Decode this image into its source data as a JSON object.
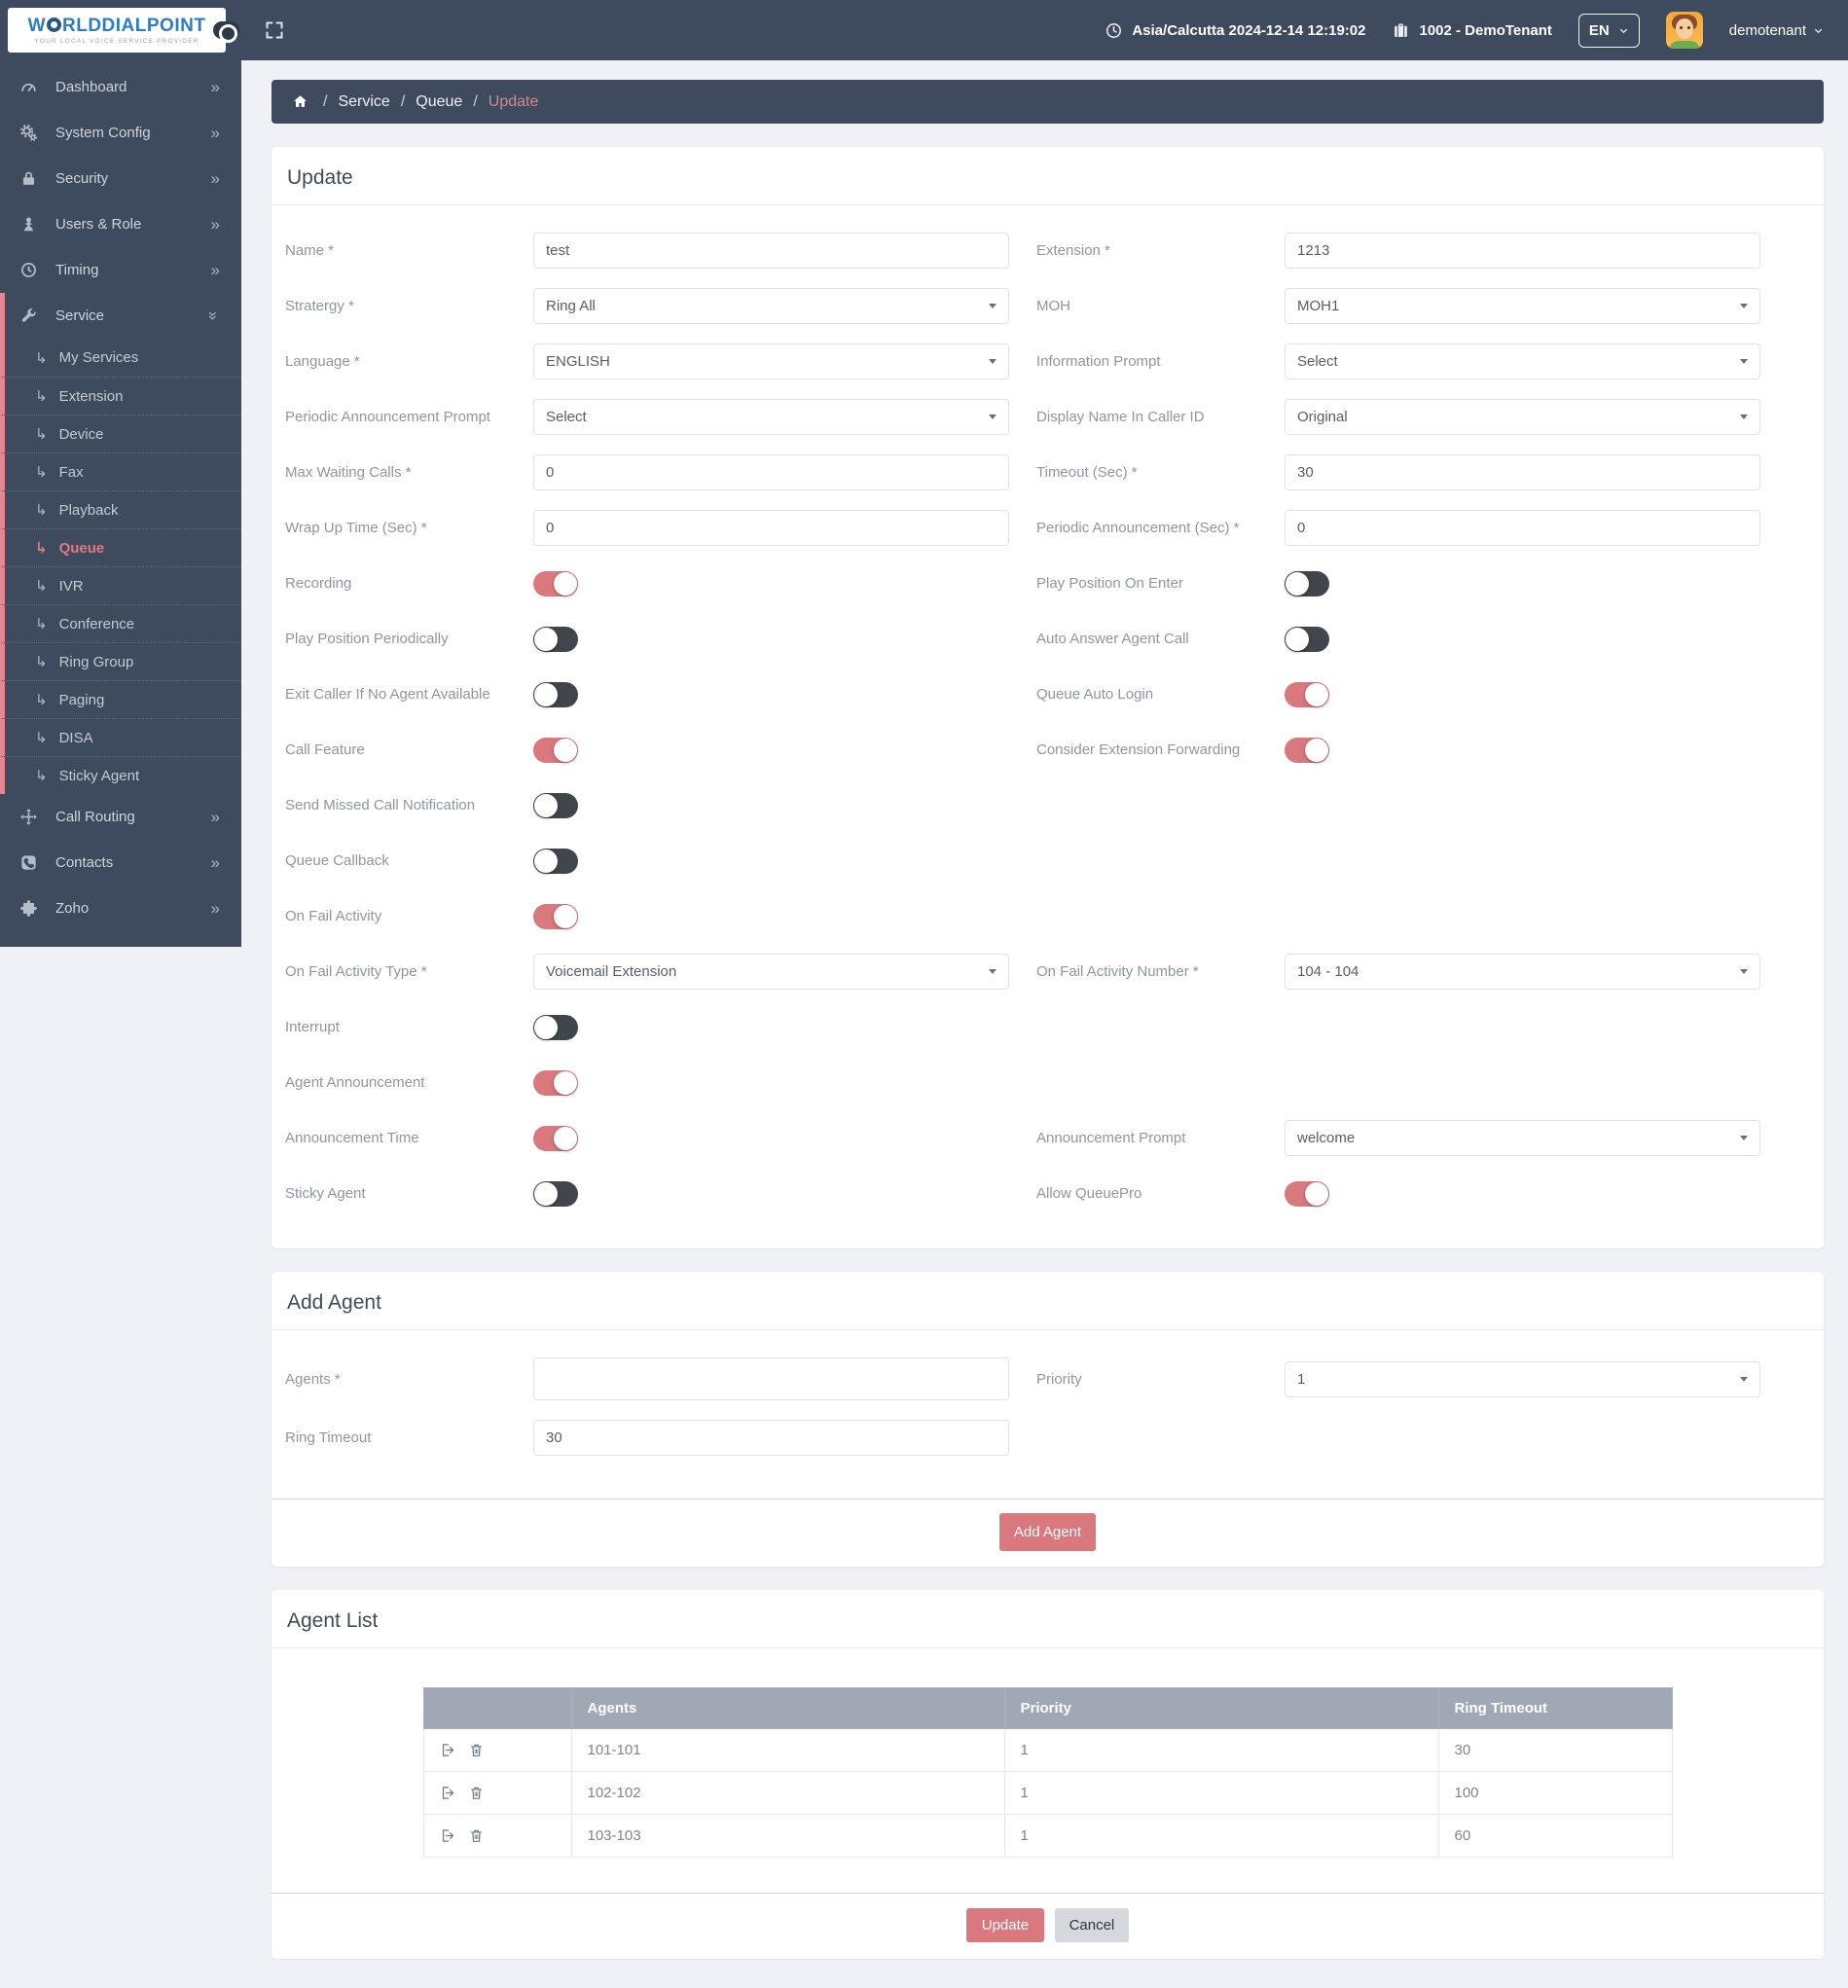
{
  "colors": {
    "accent": "#d9787d",
    "dark_bar": "#3e4b5f",
    "table_header": "#a1a8b5",
    "active_link": "#e0787f",
    "brand_blue": "#2f7bbd"
  },
  "header": {
    "brand": "WORLDDIALPOINT",
    "tagline": "YOUR LOCAL VOICE SERVICE PROVIDER",
    "timezone": "Asia/Calcutta 2024-12-14 12:19:02",
    "tenant": "1002 - DemoTenant",
    "language": "EN",
    "username": "demotenant"
  },
  "sidebar": {
    "items": [
      {
        "label": "Dashboard",
        "icon": "gauge",
        "chevron": "right"
      },
      {
        "label": "System Config",
        "icon": "gears",
        "chevron": "right"
      },
      {
        "label": "Security",
        "icon": "lock",
        "chevron": "right"
      },
      {
        "label": "Users & Role",
        "icon": "user",
        "chevron": "right"
      },
      {
        "label": "Timing",
        "icon": "clock",
        "chevron": "right"
      },
      {
        "label": "Service",
        "icon": "wrench",
        "chevron": "down",
        "pink": true
      },
      {
        "label": "My Services",
        "sub": true
      },
      {
        "label": "Extension",
        "sub": true
      },
      {
        "label": "Device",
        "sub": true
      },
      {
        "label": "Fax",
        "sub": true
      },
      {
        "label": "Playback",
        "sub": true
      },
      {
        "label": "Queue",
        "sub": true,
        "active": true
      },
      {
        "label": "IVR",
        "sub": true
      },
      {
        "label": "Conference",
        "sub": true
      },
      {
        "label": "Ring Group",
        "sub": true
      },
      {
        "label": "Paging",
        "sub": true
      },
      {
        "label": "DISA",
        "sub": true
      },
      {
        "label": "Sticky Agent",
        "sub": true
      },
      {
        "label": "Call Routing",
        "icon": "move",
        "chevron": "right"
      },
      {
        "label": "Contacts",
        "icon": "phone",
        "chevron": "right"
      },
      {
        "label": "Zoho",
        "icon": "puzzle",
        "chevron": "right"
      }
    ]
  },
  "breadcrumb": {
    "items": [
      {
        "label": "Service",
        "active": false
      },
      {
        "label": "Queue",
        "active": false
      },
      {
        "label": "Update",
        "active": true
      }
    ]
  },
  "update_form": {
    "title": "Update",
    "rows": [
      [
        {
          "label": "Name *",
          "type": "input",
          "value": "test"
        },
        {
          "label": "Extension *",
          "type": "input",
          "value": "1213"
        }
      ],
      [
        {
          "label": "Stratergy *",
          "type": "select",
          "value": "Ring All"
        },
        {
          "label": "MOH",
          "type": "select",
          "value": "MOH1"
        }
      ],
      [
        {
          "label": "Language *",
          "type": "select",
          "value": "ENGLISH"
        },
        {
          "label": "Information Prompt",
          "type": "select",
          "value": "Select"
        }
      ],
      [
        {
          "label": "Periodic Announcement Prompt",
          "type": "select",
          "value": "Select"
        },
        {
          "label": "Display Name In Caller ID",
          "type": "select",
          "value": "Original"
        }
      ],
      [
        {
          "label": "Max Waiting Calls *",
          "type": "input",
          "value": "0"
        },
        {
          "label": "Timeout (Sec) *",
          "type": "input",
          "value": "30"
        }
      ],
      [
        {
          "label": "Wrap Up Time (Sec) *",
          "type": "input",
          "value": "0"
        },
        {
          "label": "Periodic Announcement (Sec) *",
          "type": "input",
          "value": "0"
        }
      ],
      [
        {
          "label": "Recording",
          "type": "toggle",
          "on": true
        },
        {
          "label": "Play Position On Enter",
          "type": "toggle",
          "on": false
        }
      ],
      [
        {
          "label": "Play Position Periodically",
          "type": "toggle",
          "on": false
        },
        {
          "label": "Auto Answer Agent Call",
          "type": "toggle",
          "on": false
        }
      ],
      [
        {
          "label": "Exit Caller If No Agent Available",
          "type": "toggle",
          "on": false
        },
        {
          "label": "Queue Auto Login",
          "type": "toggle",
          "on": true
        }
      ],
      [
        {
          "label": "Call Feature",
          "type": "toggle",
          "on": true
        },
        {
          "label": "Consider Extension Forwarding",
          "type": "toggle",
          "on": true
        }
      ],
      [
        {
          "label": "Send Missed Call Notification",
          "type": "toggle",
          "on": false
        },
        null
      ],
      [
        {
          "label": "Queue Callback",
          "type": "toggle",
          "on": false
        },
        null
      ],
      [
        {
          "label": "On Fail Activity",
          "type": "toggle",
          "on": true
        },
        null
      ],
      [
        {
          "label": "On Fail Activity Type *",
          "type": "select",
          "value": "Voicemail Extension"
        },
        {
          "label": "On Fail Activity Number *",
          "type": "select",
          "value": "104 - 104"
        }
      ],
      [
        {
          "label": "Interrupt",
          "type": "toggle",
          "on": false
        },
        null
      ],
      [
        {
          "label": "Agent Announcement",
          "type": "toggle",
          "on": true
        },
        null
      ],
      [
        {
          "label": "Announcement Time",
          "type": "toggle",
          "on": true
        },
        {
          "label": "Announcement Prompt",
          "type": "select",
          "value": "welcome"
        }
      ],
      [
        {
          "label": "Sticky Agent",
          "type": "toggle",
          "on": false
        },
        {
          "label": "Allow QueuePro",
          "type": "toggle",
          "on": true
        }
      ]
    ]
  },
  "add_agent": {
    "title": "Add Agent",
    "agents_label": "Agents *",
    "agents_value": "",
    "priority_label": "Priority",
    "priority_value": "1",
    "ring_timeout_label": "Ring Timeout",
    "ring_timeout_value": "30",
    "button": "Add Agent"
  },
  "agent_list": {
    "title": "Agent List",
    "columns": [
      "",
      "Agents",
      "Priority",
      "Ring Timeout"
    ],
    "rows": [
      {
        "agents": "101-101",
        "priority": "1",
        "ring_timeout": "30"
      },
      {
        "agents": "102-102",
        "priority": "1",
        "ring_timeout": "100"
      },
      {
        "agents": "103-103",
        "priority": "1",
        "ring_timeout": "60"
      }
    ]
  },
  "footer": {
    "update": "Update",
    "cancel": "Cancel"
  }
}
